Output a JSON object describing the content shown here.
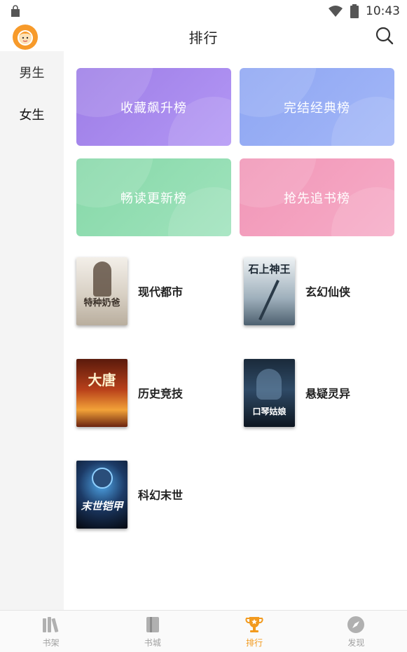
{
  "status_bar": {
    "time": "10:43"
  },
  "header": {
    "title": "排行"
  },
  "sidebar": {
    "items": [
      {
        "label": "男生"
      },
      {
        "label": "女生"
      }
    ]
  },
  "ranking_cards": [
    {
      "label": "收藏飙升榜",
      "color": "#a98af0"
    },
    {
      "label": "完结经典榜",
      "color": "#97aef5"
    },
    {
      "label": "畅读更新榜",
      "color": "#8fdbb0"
    },
    {
      "label": "抢先追书榜",
      "color": "#f4a0be"
    }
  ],
  "categories": [
    {
      "label": "现代都市",
      "cover_text": "特种奶爸"
    },
    {
      "label": "玄幻仙侠",
      "cover_text": "石上神王"
    },
    {
      "label": "历史竞技",
      "cover_text": "大唐"
    },
    {
      "label": "悬疑灵异",
      "cover_text": "口琴姑娘"
    },
    {
      "label": "科幻末世",
      "cover_text": "末世铠甲"
    }
  ],
  "tabbar": {
    "items": [
      {
        "label": "书架",
        "icon": "books-icon"
      },
      {
        "label": "书城",
        "icon": "book-icon"
      },
      {
        "label": "排行",
        "icon": "trophy-icon"
      },
      {
        "label": "发现",
        "icon": "compass-icon"
      }
    ],
    "active": "排行",
    "accent_color": "#f29a1e"
  }
}
